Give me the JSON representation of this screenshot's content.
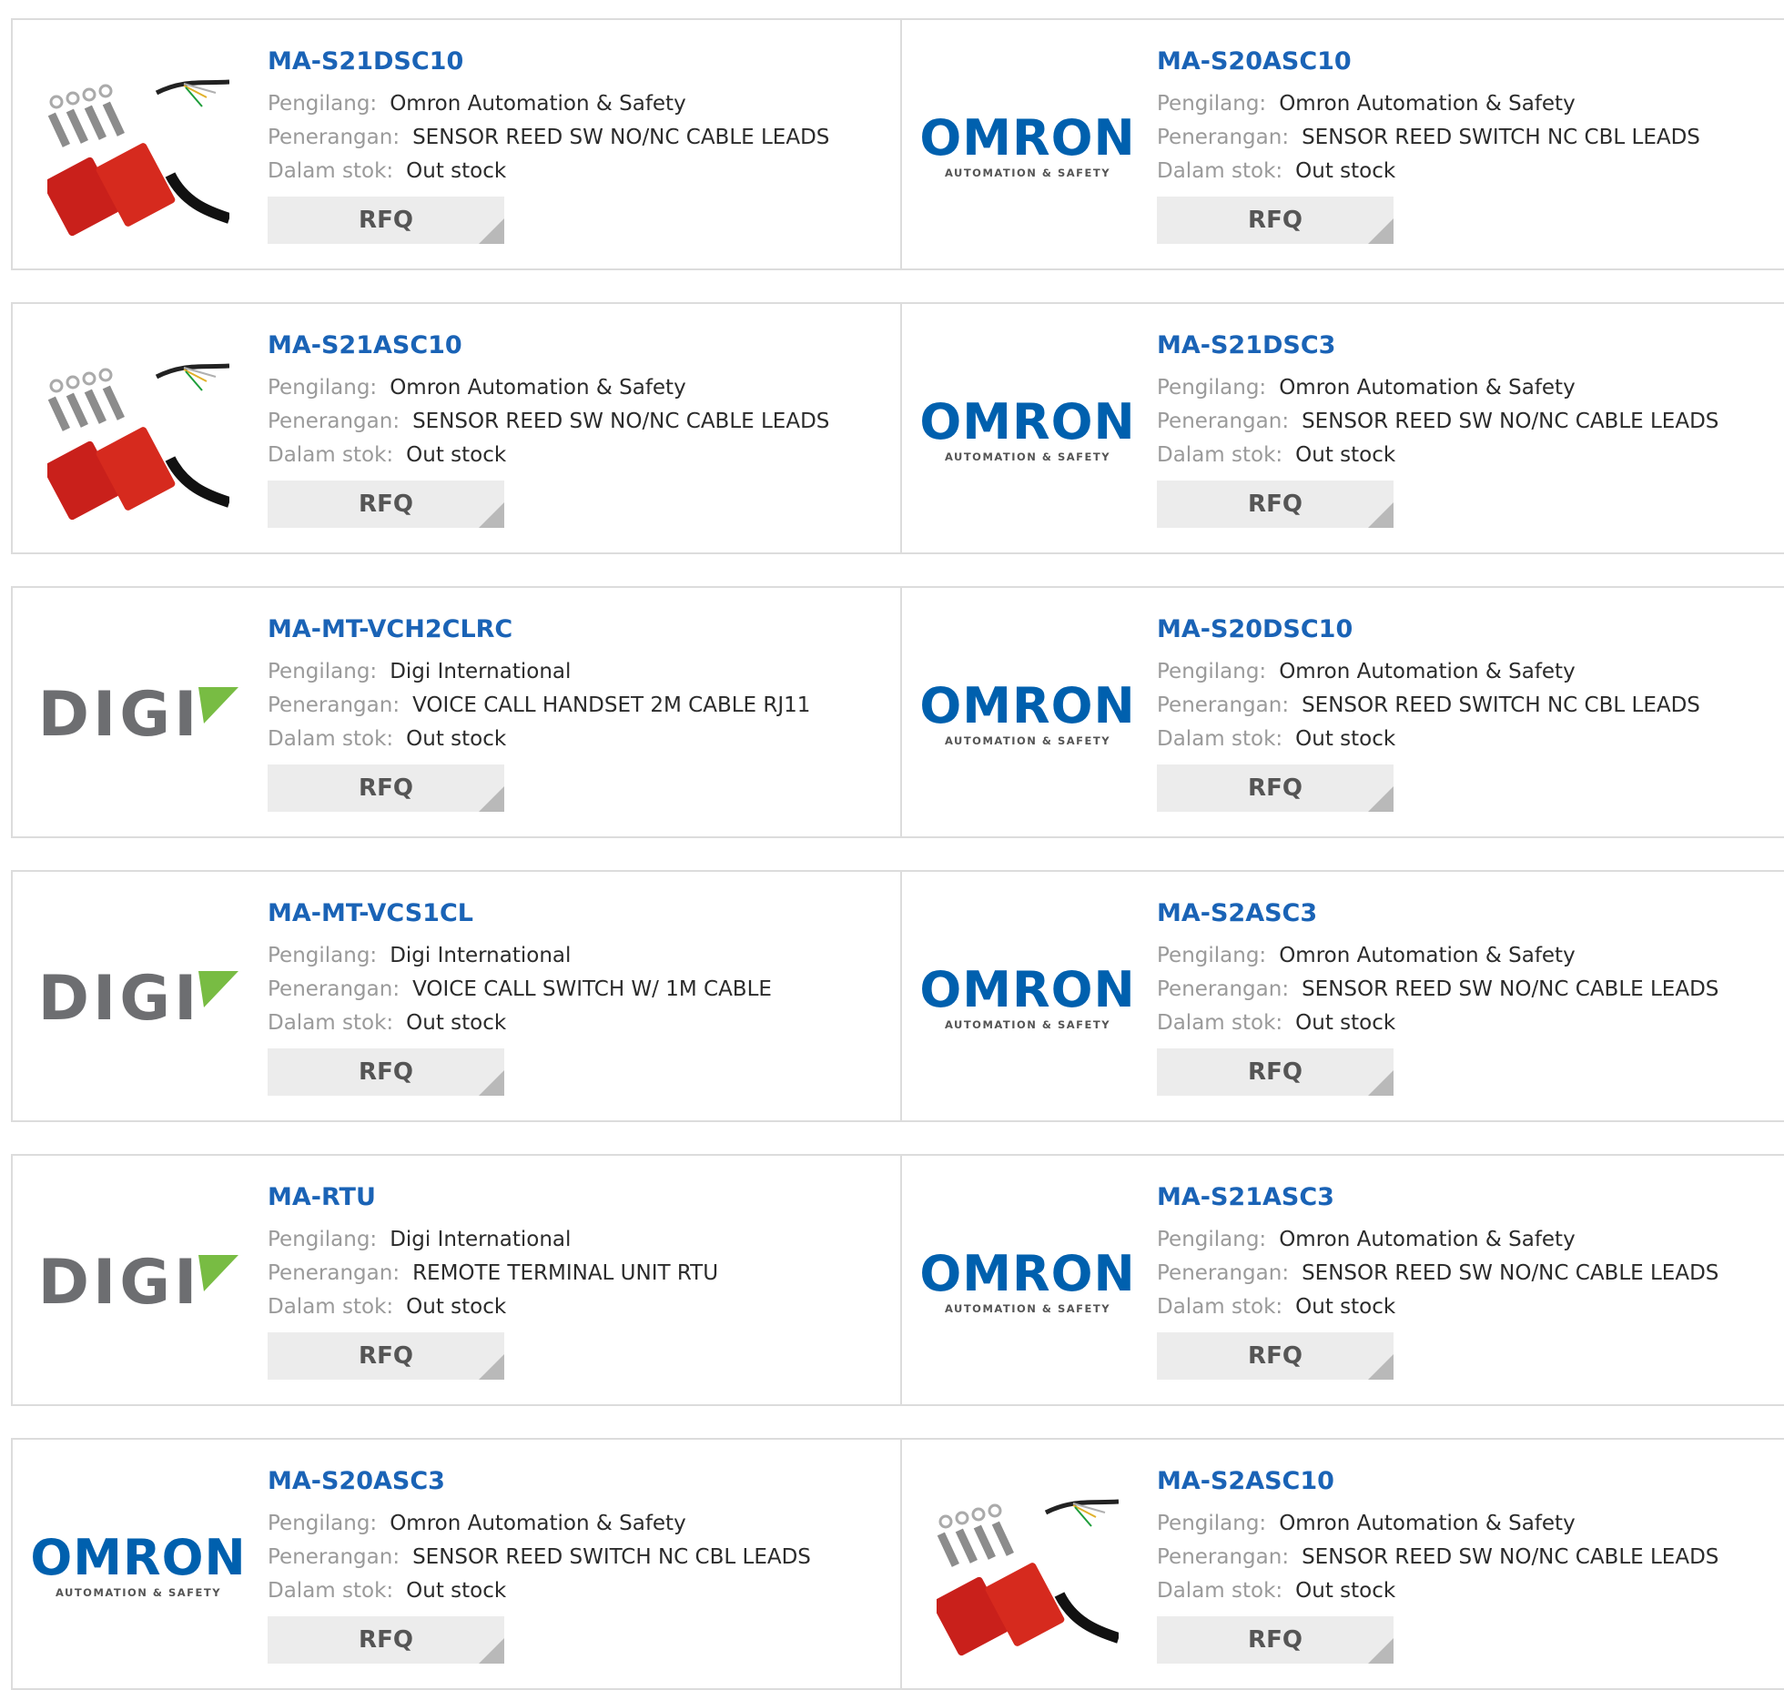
{
  "labels": {
    "manufacturer": "Pengilang:",
    "description": "Penerangan:",
    "stock": "Dalam stok:",
    "rfq": "RFQ"
  },
  "brand": {
    "omron": "OMRON",
    "omron_tagline": "AUTOMATION & SAFETY",
    "digi": "DIGI"
  },
  "colors": {
    "part_link": "#1a63b6",
    "omron_blue": "#0060ae",
    "digi_gray": "#6d6e71",
    "digi_green": "#78bc43",
    "rfq_bg": "#ececec"
  },
  "products": [
    {
      "part": "MA-S21DSC10",
      "manufacturer": "Omron Automation & Safety",
      "description": "SENSOR REED SW NO/NC CABLE LEADS",
      "stock": "Out stock",
      "image": "photo-reed-switch"
    },
    {
      "part": "MA-S20ASC10",
      "manufacturer": "Omron Automation & Safety",
      "description": "SENSOR REED SWITCH NC CBL LEADS",
      "stock": "Out stock",
      "image": "omron-logo"
    },
    {
      "part": "MA-S21ASC10",
      "manufacturer": "Omron Automation & Safety",
      "description": "SENSOR REED SW NO/NC CABLE LEADS",
      "stock": "Out stock",
      "image": "photo-reed-switch"
    },
    {
      "part": "MA-S21DSC3",
      "manufacturer": "Omron Automation & Safety",
      "description": "SENSOR REED SW NO/NC CABLE LEADS",
      "stock": "Out stock",
      "image": "omron-logo"
    },
    {
      "part": "MA-MT-VCH2CLRC",
      "manufacturer": "Digi International",
      "description": "VOICE CALL HANDSET 2M CABLE RJ11",
      "stock": "Out stock",
      "image": "digi-logo"
    },
    {
      "part": "MA-S20DSC10",
      "manufacturer": "Omron Automation & Safety",
      "description": "SENSOR REED SWITCH NC CBL LEADS",
      "stock": "Out stock",
      "image": "omron-logo"
    },
    {
      "part": "MA-MT-VCS1CL",
      "manufacturer": "Digi International",
      "description": "VOICE CALL SWITCH W/ 1M CABLE",
      "stock": "Out stock",
      "image": "digi-logo"
    },
    {
      "part": "MA-S2ASC3",
      "manufacturer": "Omron Automation & Safety",
      "description": "SENSOR REED SW NO/NC CABLE LEADS",
      "stock": "Out stock",
      "image": "omron-logo"
    },
    {
      "part": "MA-RTU",
      "manufacturer": "Digi International",
      "description": "REMOTE TERMINAL UNIT RTU",
      "stock": "Out stock",
      "image": "digi-logo"
    },
    {
      "part": "MA-S21ASC3",
      "manufacturer": "Omron Automation & Safety",
      "description": "SENSOR REED SW NO/NC CABLE LEADS",
      "stock": "Out stock",
      "image": "omron-logo"
    },
    {
      "part": "MA-S20ASC3",
      "manufacturer": "Omron Automation & Safety",
      "description": "SENSOR REED SWITCH NC CBL LEADS",
      "stock": "Out stock",
      "image": "omron-logo"
    },
    {
      "part": "MA-S2ASC10",
      "manufacturer": "Omron Automation & Safety",
      "description": "SENSOR REED SW NO/NC CABLE LEADS",
      "stock": "Out stock",
      "image": "photo-reed-switch"
    }
  ]
}
